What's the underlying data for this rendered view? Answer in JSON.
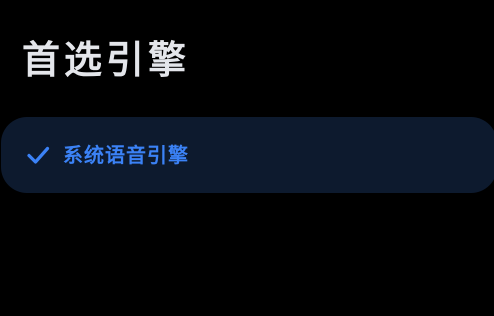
{
  "page": {
    "title": "首选引擎"
  },
  "engine_options": [
    {
      "label": "系统语音引擎",
      "selected": true,
      "icon": "check-icon"
    }
  ],
  "colors": {
    "background": "#000000",
    "title_text": "#e4e6eb",
    "selected_option_background": "#0d1a2e",
    "accent": "#3b82f6"
  }
}
